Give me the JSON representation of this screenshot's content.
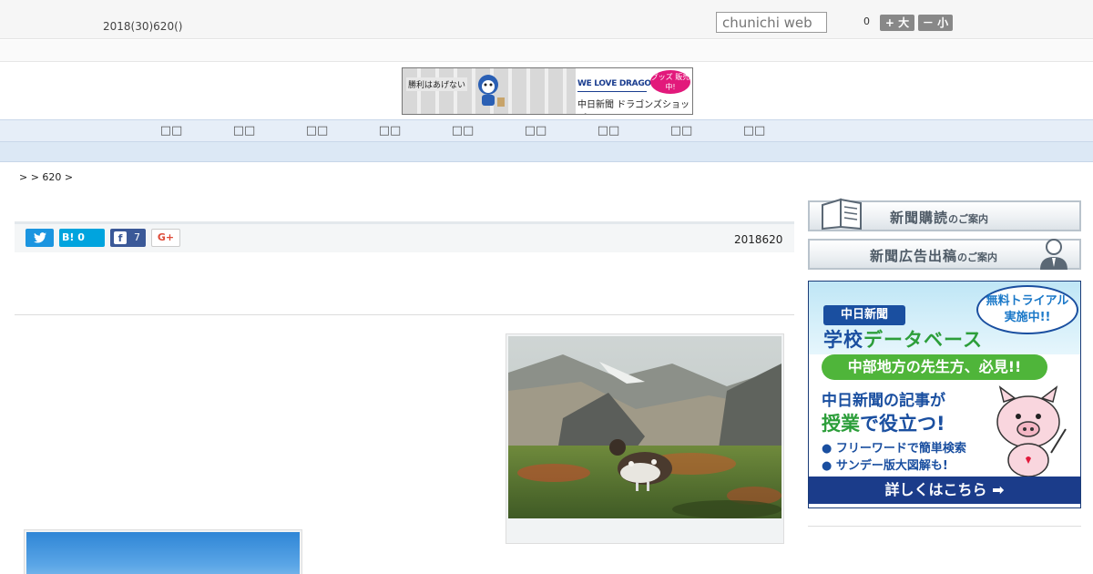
{
  "header": {
    "date": "2018(30)620()",
    "search_placeholder": "chunichi web",
    "font_size_label": "0",
    "font_larger": "+ 大",
    "font_smaller": "－ 小"
  },
  "banner": {
    "slogan": "勝利はあげない",
    "brand": "WE LOVE DRAGONS",
    "shop": "中日新聞 ドラゴンズショップ",
    "badge": "グッズ 販売中!"
  },
  "nav": {
    "items": [
      "",
      "",
      "",
      "",
      "",
      "",
      "",
      "",
      ""
    ]
  },
  "breadcrumb": ">  > 620 >",
  "share": {
    "twitter_label": "",
    "hatena_label": "B! 0",
    "facebook_count": "7",
    "gplus_label": "G+",
    "article_date": "2018620"
  },
  "sidebar": {
    "subscribe_main": "新聞購読",
    "subscribe_sub": "のご案内",
    "ad_main": "新聞広告出稿",
    "ad_sub": "のご案内",
    "school_ad": {
      "brand": "中日新聞",
      "title_a": "学校",
      "title_b": "データベース",
      "bubble": "無料トライアル 実施中!!",
      "green": "中部地方の先生方、必見!!",
      "line1": "中日新聞の記事が",
      "line2_a": "授業",
      "line2_b": "で役立つ!",
      "bullet1": "● フリーワードで簡単検索",
      "bullet2": "● サンデー版大図解も!",
      "cta": "詳しくはこちら ➡"
    }
  },
  "colors": {
    "nav_bg": "#e6eef8",
    "twitter": "#1b95e0",
    "hatena": "#00a4de",
    "facebook": "#3b5998",
    "ad_blue": "#1a4fa0",
    "ad_green": "#4fb53a"
  }
}
